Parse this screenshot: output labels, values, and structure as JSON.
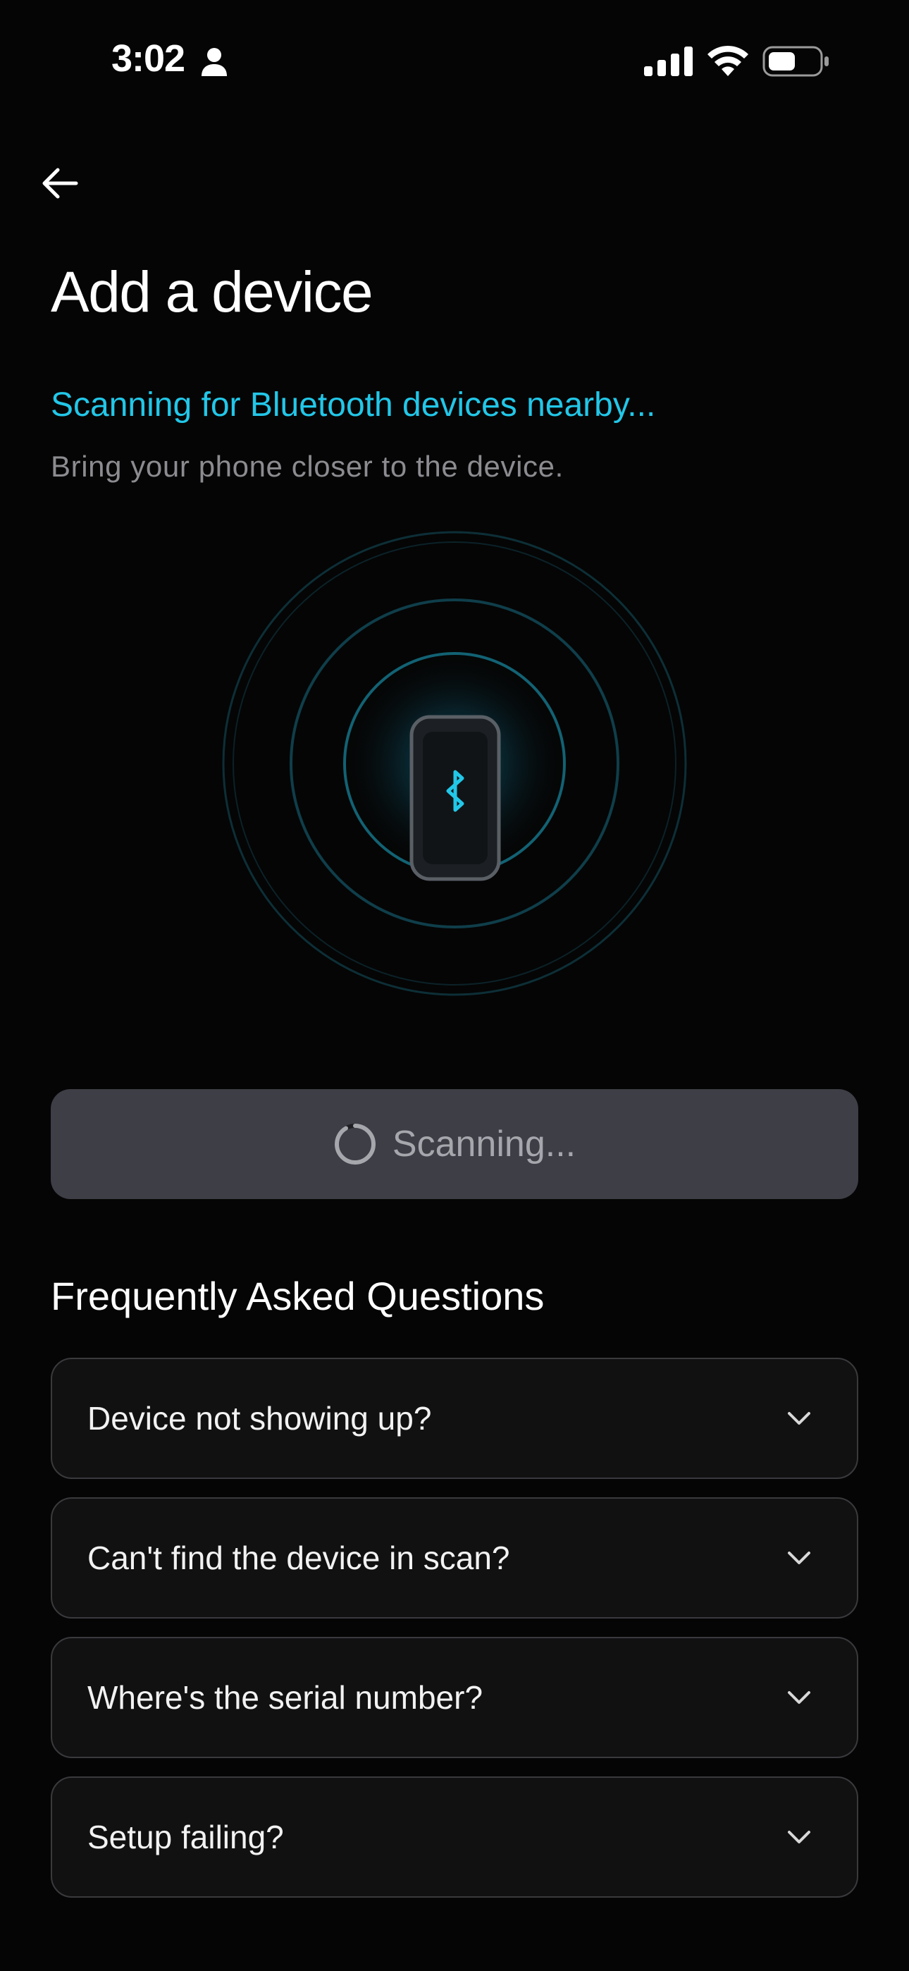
{
  "status_bar": {
    "time": "3:02",
    "battery_level": 0.55
  },
  "header": {
    "back_icon": "arrow-left-icon",
    "title": "Add a device"
  },
  "scan": {
    "status_text": "Scanning for Bluetooth devices nearby...",
    "hint_text": "Bring your phone closer to the device.",
    "illustration_icon": "bluetooth-icon",
    "button_label": "Scanning..."
  },
  "faq": {
    "heading": "Frequently Asked Questions",
    "items": [
      {
        "question": "Device not showing up?"
      },
      {
        "question": "Can't find the device in scan?"
      },
      {
        "question": "Where's the serial number?"
      },
      {
        "question": "Setup failing?"
      }
    ]
  },
  "colors": {
    "accent": "#22c7e8",
    "background": "#050505",
    "button_disabled": "#3e3e47",
    "card": "#111112"
  }
}
